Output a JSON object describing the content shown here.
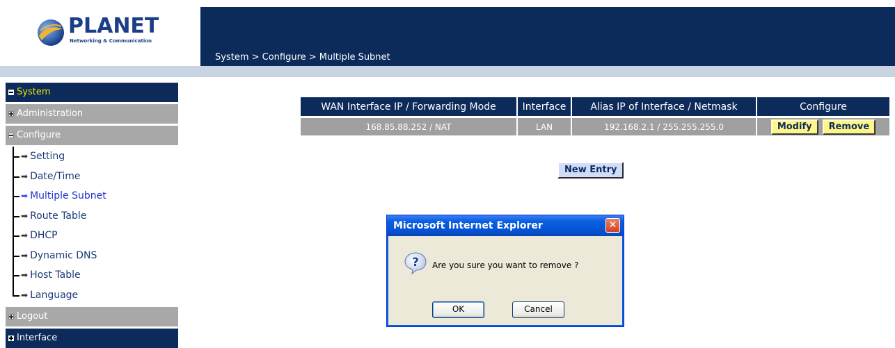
{
  "header": {
    "logo_text": "PLANET",
    "logo_tagline": "Networking & Communication",
    "breadcrumb": "System > Configure > Multiple Subnet"
  },
  "sidebar": {
    "system": "System",
    "administration": "Administration",
    "configure": "Configure",
    "items": [
      "Setting",
      "Date/Time",
      "Multiple Subnet",
      "Route Table",
      "DHCP",
      "Dynamic DNS",
      "Host Table",
      "Language"
    ],
    "active_item": "Multiple Subnet",
    "logout": "Logout",
    "interface": "Interface"
  },
  "table": {
    "headers": [
      "WAN Interface IP / Forwarding Mode",
      "Interface",
      "Alias IP of Interface / Netmask",
      "Configure"
    ],
    "rows": [
      {
        "wan": "168.85.88.252 / NAT",
        "interface": "LAN",
        "alias": "192.168.2.1 / 255.255.255.0"
      }
    ],
    "modify_label": "Modify",
    "remove_label": "Remove"
  },
  "new_entry_label": "New Entry",
  "dialog": {
    "title": "Microsoft Internet Explorer",
    "message": "Are you sure you want to remove ?",
    "ok_label": "OK",
    "cancel_label": "Cancel"
  },
  "colors": {
    "navy": "#0c2b5a",
    "gray": "#a0a0a0",
    "system_label": "#e6e600",
    "button_yellow": "#fff68a",
    "dialog_blue": "#0a5ee0"
  },
  "icons": {
    "logo": "planet-sphere-icon",
    "question": "question-icon",
    "close": "close-icon",
    "arrow": "arrow-right-icon"
  }
}
